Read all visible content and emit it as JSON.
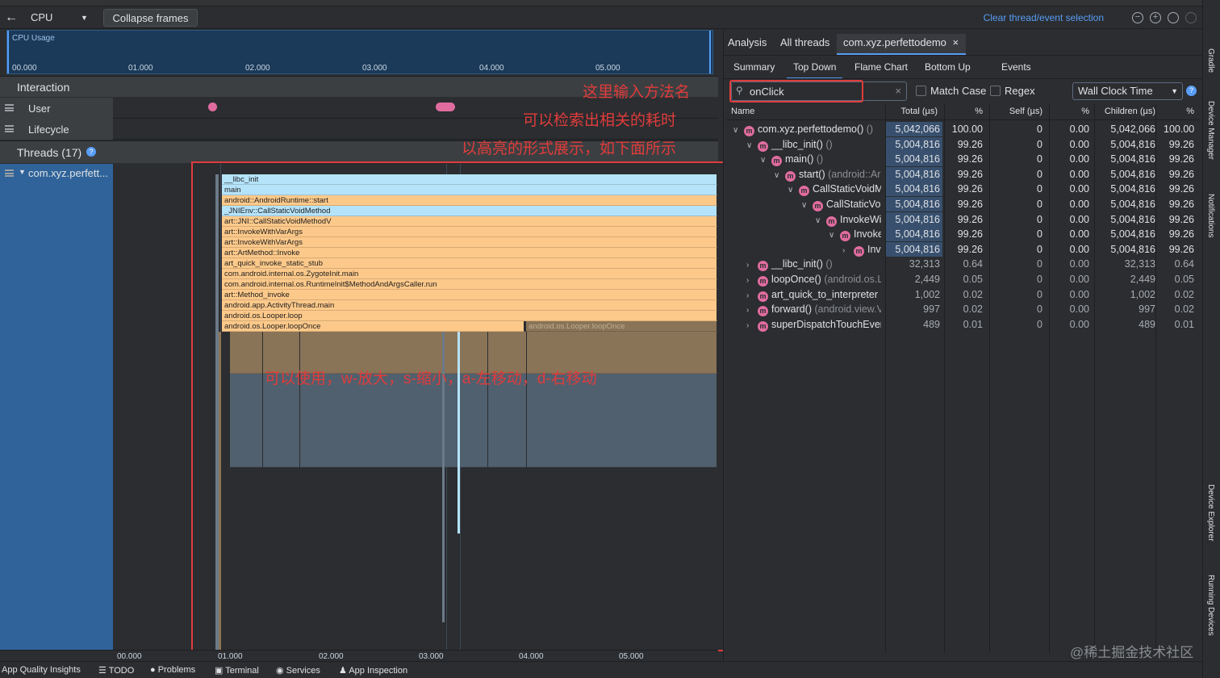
{
  "toolbar": {
    "back": "←",
    "cpu_label": "CPU",
    "collapse_label": "Collapse frames",
    "clear_label": "Clear thread/event selection",
    "zoom_out": "−",
    "zoom_in": "+",
    "reset": "⊖",
    "more": "⋮"
  },
  "cpu_usage": {
    "label": "CPU Usage",
    "ticks": [
      "00.000",
      "01.000",
      "02.000",
      "03.000",
      "04.000",
      "05.000"
    ]
  },
  "interaction": {
    "title": "Interaction",
    "rows": [
      "User",
      "Lifecycle"
    ]
  },
  "threads": {
    "title": "Threads (17)",
    "thread_name": "com.xyz.perfett..."
  },
  "flame": {
    "frames": [
      "__libc_init",
      "main",
      "android::AndroidRuntime::start",
      "_JNIEnv::CallStaticVoidMethod",
      "art::JNI::CallStaticVoidMethodV",
      "art::InvokeWithVarArgs",
      "art::InvokeWithVarArgs",
      "art::ArtMethod::Invoke",
      "art_quick_invoke_static_stub",
      "com.android.internal.os.ZygoteInit.main",
      "com.android.internal.os.RuntimeInit$MethodAndArgsCaller.run",
      "art::Method_invoke",
      "android.app.ActivityThread.main",
      "android.os.Looper.loop",
      "android.os.Looper.loopOnce"
    ],
    "sub_frame": "android.os.Looper.loopOnce"
  },
  "bottom_axis": [
    "00.000",
    "01.000",
    "02.000",
    "03.000",
    "04.000",
    "05.000"
  ],
  "annotations": {
    "search_hint_1": "这里输入方法名",
    "search_hint_2": "可以检索出相关的耗时",
    "search_hint_3": "以高亮的形式展示，如下面所示",
    "keys_hint": "可以使用，w-放大，s-缩小，a-左移动，d-右移动"
  },
  "right_tabs": {
    "top": [
      "Analysis",
      "All threads",
      "com.xyz.perfettodemo"
    ],
    "close": "×",
    "sub": [
      "Summary",
      "Top Down",
      "Flame Chart",
      "Bottom Up",
      "Events"
    ]
  },
  "search": {
    "value": "onClick",
    "clear": "×",
    "match_case": "Match Case",
    "regex": "Regex",
    "clock": "Wall Clock Time",
    "help": "?"
  },
  "table": {
    "headers": [
      "Name",
      "Total (µs)",
      "%",
      "Self (µs)",
      "%",
      "Children (µs)",
      "%"
    ],
    "rows": [
      {
        "indent": 0,
        "chev": "∨",
        "name": "com.xyz.perfettodemo()",
        "gray": " ()",
        "total": "5,042,066",
        "tp": "100.00",
        "self": "0",
        "sp": "0.00",
        "child": "5,042,066",
        "cp": "100.00",
        "hl": true
      },
      {
        "indent": 1,
        "chev": "∨",
        "name": "__libc_init()",
        "gray": " ()",
        "total": "5,004,816",
        "tp": "99.26",
        "self": "0",
        "sp": "0.00",
        "child": "5,004,816",
        "cp": "99.26",
        "hl": true
      },
      {
        "indent": 2,
        "chev": "∨",
        "name": "main()",
        "gray": " ()",
        "total": "5,004,816",
        "tp": "99.26",
        "self": "0",
        "sp": "0.00",
        "child": "5,004,816",
        "cp": "99.26",
        "hl": true
      },
      {
        "indent": 3,
        "chev": "∨",
        "name": "start()",
        "gray": " (android::Ar",
        "total": "5,004,816",
        "tp": "99.26",
        "self": "0",
        "sp": "0.00",
        "child": "5,004,816",
        "cp": "99.26",
        "hl": true
      },
      {
        "indent": 4,
        "chev": "∨",
        "name": "CallStaticVoidM",
        "gray": "",
        "total": "5,004,816",
        "tp": "99.26",
        "self": "0",
        "sp": "0.00",
        "child": "5,004,816",
        "cp": "99.26",
        "hl": true
      },
      {
        "indent": 5,
        "chev": "∨",
        "name": "CallStaticVoi",
        "gray": "",
        "total": "5,004,816",
        "tp": "99.26",
        "self": "0",
        "sp": "0.00",
        "child": "5,004,816",
        "cp": "99.26",
        "hl": true
      },
      {
        "indent": 6,
        "chev": "∨",
        "name": "InvokeWit",
        "gray": "",
        "total": "5,004,816",
        "tp": "99.26",
        "self": "0",
        "sp": "0.00",
        "child": "5,004,816",
        "cp": "99.26",
        "hl": true
      },
      {
        "indent": 7,
        "chev": "∨",
        "name": "Invoke",
        "gray": "",
        "total": "5,004,816",
        "tp": "99.26",
        "self": "0",
        "sp": "0.00",
        "child": "5,004,816",
        "cp": "99.26",
        "hl": true
      },
      {
        "indent": 8,
        "chev": "›",
        "name": "Invo",
        "gray": "",
        "total": "5,004,816",
        "tp": "99.26",
        "self": "0",
        "sp": "0.00",
        "child": "5,004,816",
        "cp": "99.26",
        "hl": true
      },
      {
        "indent": 1,
        "chev": "›",
        "name": "__libc_init()",
        "gray": " ()",
        "total": "32,313",
        "tp": "0.64",
        "self": "0",
        "sp": "0.00",
        "child": "32,313",
        "cp": "0.64",
        "hl": false
      },
      {
        "indent": 1,
        "chev": "›",
        "name": "loopOnce()",
        "gray": " (android.os.L",
        "total": "2,449",
        "tp": "0.05",
        "self": "0",
        "sp": "0.00",
        "child": "2,449",
        "cp": "0.05",
        "hl": false
      },
      {
        "indent": 1,
        "chev": "›",
        "name": "art_quick_to_interpreter",
        "gray": "",
        "total": "1,002",
        "tp": "0.02",
        "self": "0",
        "sp": "0.00",
        "child": "1,002",
        "cp": "0.02",
        "hl": false
      },
      {
        "indent": 1,
        "chev": "›",
        "name": "forward()",
        "gray": " (android.view.V",
        "total": "997",
        "tp": "0.02",
        "self": "0",
        "sp": "0.00",
        "child": "997",
        "cp": "0.02",
        "hl": false
      },
      {
        "indent": 1,
        "chev": "›",
        "name": "superDispatchTouchEver",
        "gray": "",
        "total": "489",
        "tp": "0.01",
        "self": "0",
        "sp": "0.00",
        "child": "489",
        "cp": "0.01",
        "hl": false
      }
    ]
  },
  "side_tabs": [
    "Gradle",
    "Device Manager",
    "Notifications",
    "Device Explorer",
    "Running Devices"
  ],
  "status_bar": [
    "App Quality Insights",
    "TODO",
    "Problems",
    "Terminal",
    "Services",
    "App Inspection"
  ],
  "watermark": "@稀土掘金技术社区",
  "colors": {
    "accent": "#589df6",
    "annotation": "#e03c3c",
    "highlight": "#38506e",
    "method_icon": "#e06c9f"
  }
}
